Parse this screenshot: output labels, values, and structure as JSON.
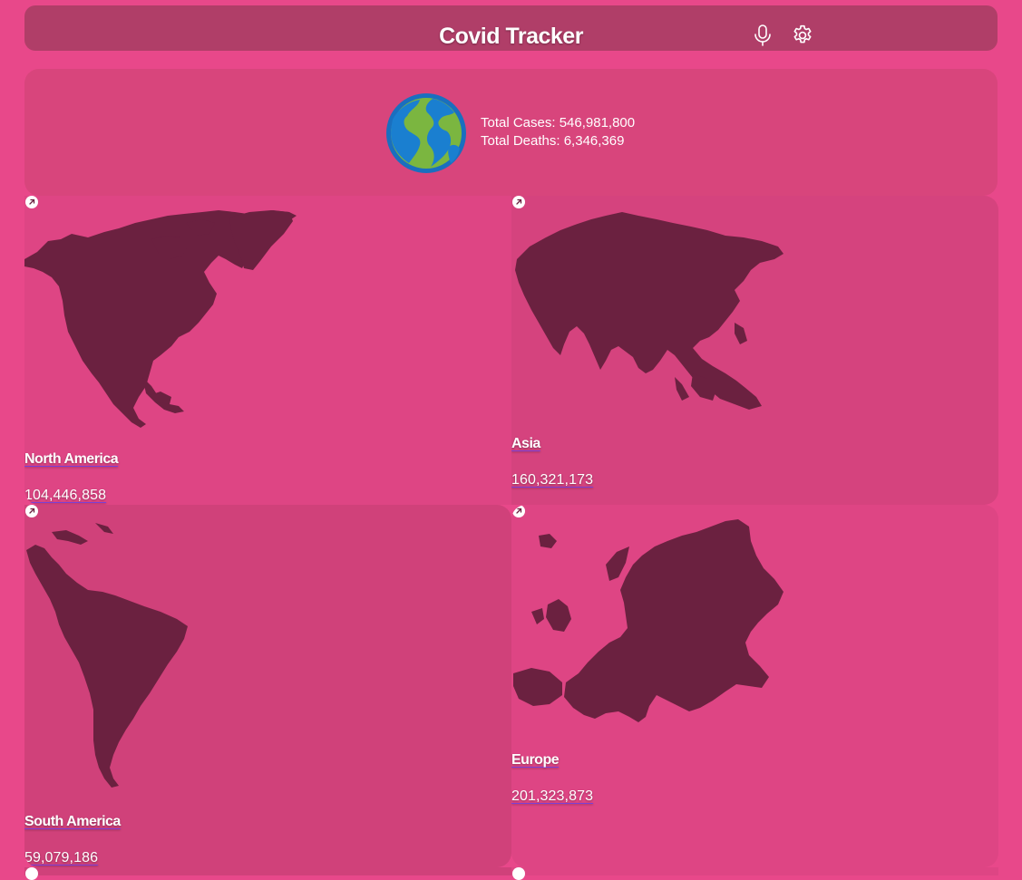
{
  "app": {
    "title": "Covid Tracker"
  },
  "header": {
    "mic_icon": "microphone-icon",
    "settings_icon": "gear-icon"
  },
  "summary": {
    "globe_icon": "globe-icon",
    "total_cases": "Total Cases: 546,981,800",
    "total_deaths": "Total Deaths: 6,346,369"
  },
  "continents": [
    {
      "name": "North America",
      "cases": "104,446,858"
    },
    {
      "name": "Asia",
      "cases": "160,321,173"
    },
    {
      "name": "South America",
      "cases": "59,079,186"
    },
    {
      "name": "Europe",
      "cases": "201,323,873"
    }
  ],
  "colors": {
    "background": "#e8488a",
    "header": "#b03e68",
    "map_fill": "#6b2140",
    "link_underline": "#7a3fd6"
  }
}
